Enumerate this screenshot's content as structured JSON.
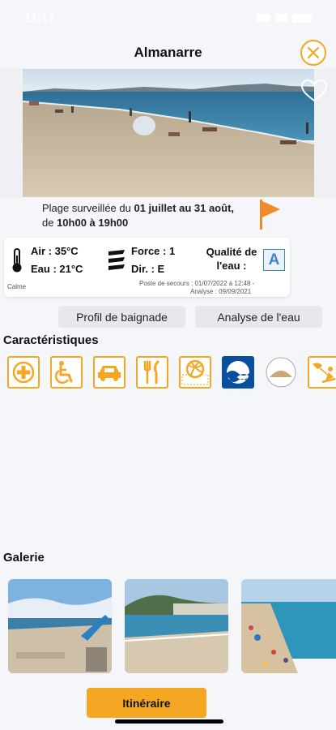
{
  "status_bar": {
    "time": "11:17"
  },
  "header": {
    "title": "Almanarre"
  },
  "surveillance": {
    "prefix": "Plage surveillée du ",
    "dates": "01 juillet au 31 août,",
    "line2_prefix": "de ",
    "hours": "10h00 à 19h00"
  },
  "weather": {
    "air": "Air : 35°C",
    "water": "Eau : 21°C",
    "sea_state": "Calme",
    "force": "Force : 1",
    "direction": "Dir. : E",
    "quality_label_1": "Qualité de",
    "quality_label_2": "l'eau :",
    "quality_grade": "A",
    "poste": "Poste de secours : 01/07/2022 à 12:48 -",
    "analyse": "Analyse : 09/09/2021"
  },
  "buttons": {
    "profil": "Profil de baignade",
    "analyse": "Analyse de l'eau",
    "route": "Itinéraire"
  },
  "sections": {
    "characteristics": "Caractéristiques",
    "gallery": "Galerie"
  },
  "features": [
    {
      "icon": "first-aid-icon"
    },
    {
      "icon": "wheelchair-icon"
    },
    {
      "icon": "car-parking-icon"
    },
    {
      "icon": "restaurant-icon"
    },
    {
      "icon": "beach-volleyball-icon"
    },
    {
      "icon": "blue-flag-icon"
    },
    {
      "icon": "sand-icon"
    },
    {
      "icon": "kitesurf-icon"
    }
  ],
  "colors": {
    "accent": "#f5a623",
    "flag": "#f08a2c",
    "quality": "#3d85c6",
    "blue_flag": "#0a4f9e"
  }
}
